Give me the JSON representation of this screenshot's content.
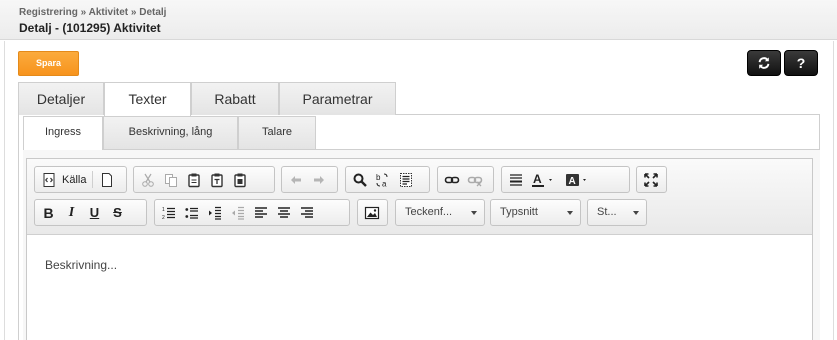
{
  "header": {
    "breadcrumb": "Registrering » Aktivitet » Detalj",
    "title": "Detalj - (101295) Aktivitet"
  },
  "actions": {
    "save_label": "Spara",
    "help_label": "?"
  },
  "main_tabs": [
    {
      "label": "Detaljer",
      "active": false
    },
    {
      "label": "Texter",
      "active": true
    },
    {
      "label": "Rabatt",
      "active": false
    },
    {
      "label": "Parametrar",
      "active": false
    }
  ],
  "sub_tabs": [
    {
      "label": "Ingress",
      "active": true
    },
    {
      "label": "Beskrivning, lång",
      "active": false
    },
    {
      "label": "Talare",
      "active": false
    }
  ],
  "editor": {
    "toolbar": {
      "source_label": "Källa",
      "format_combo": "Teckenf...",
      "font_combo": "Typsnitt",
      "size_combo": "St..."
    },
    "content_text": "Beskrivning..."
  },
  "colors": {
    "accent": "#f7941d",
    "dark_button": "#1a1a1a",
    "border": "#cfcfcf"
  }
}
